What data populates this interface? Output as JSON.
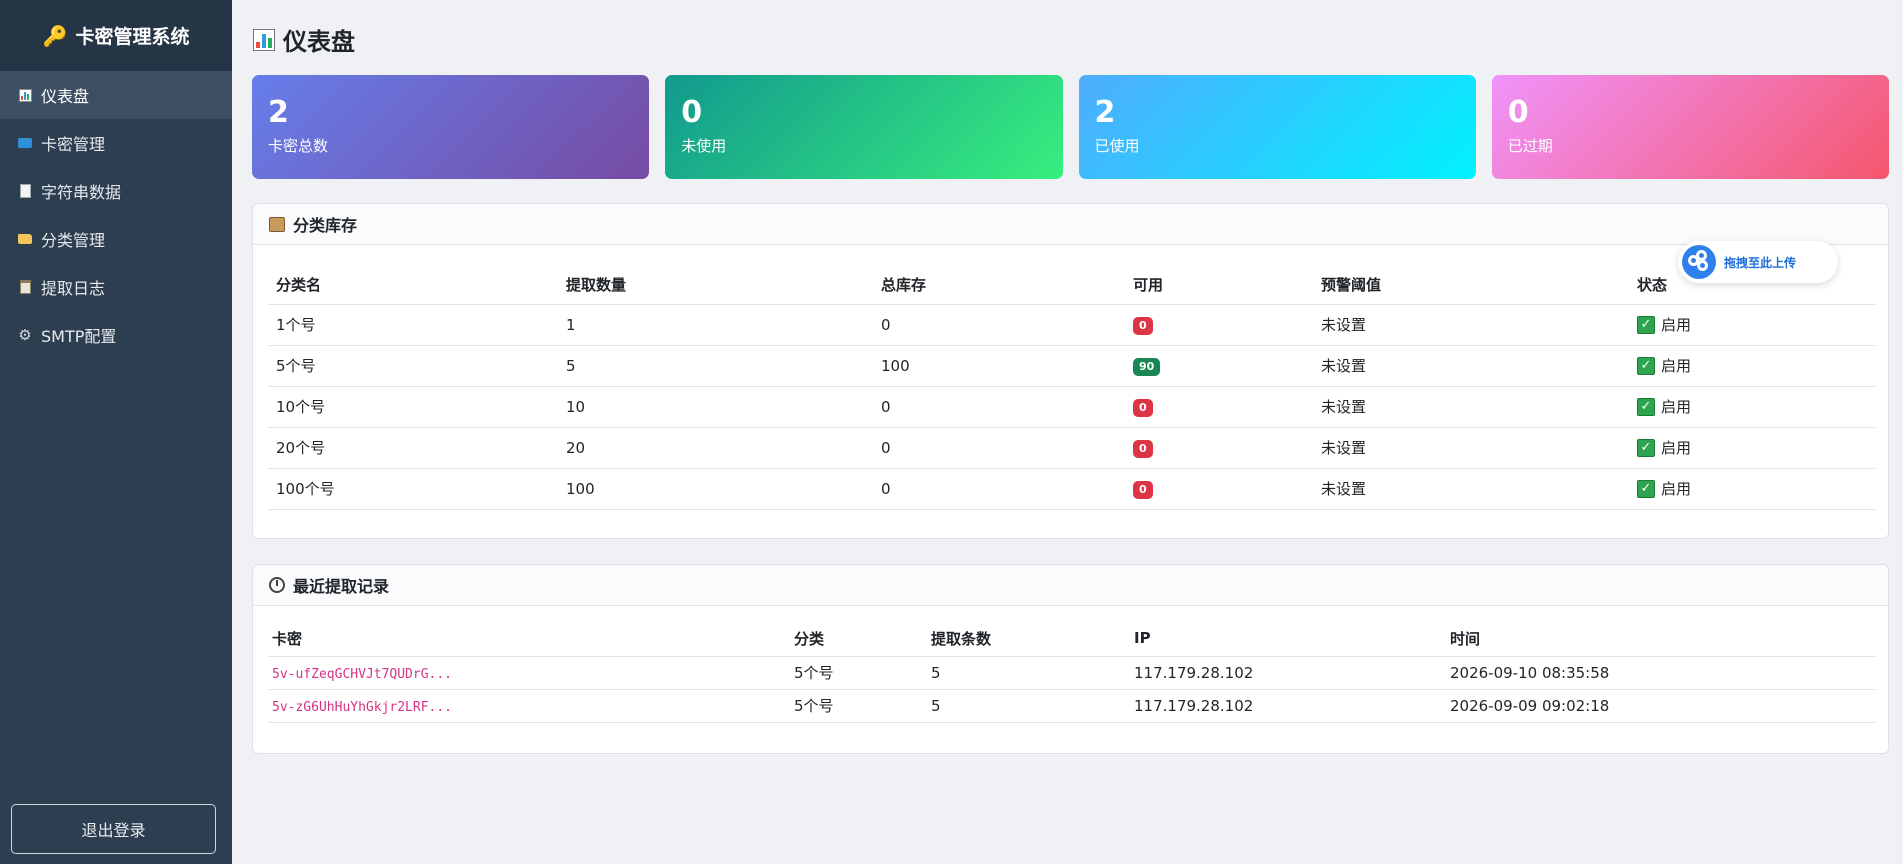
{
  "brand": {
    "title": "卡密管理系统"
  },
  "sidebar": {
    "items": [
      {
        "label": "仪表盘",
        "icon": "chart-icon",
        "active": true
      },
      {
        "label": "卡密管理",
        "icon": "card-icon"
      },
      {
        "label": "字符串数据",
        "icon": "document-icon"
      },
      {
        "label": "分类管理",
        "icon": "folder-icon"
      },
      {
        "label": "提取日志",
        "icon": "clipboard-icon"
      },
      {
        "label": "SMTP配置",
        "icon": "gear-icon"
      }
    ],
    "logout_label": "退出登录"
  },
  "page": {
    "title": "仪表盘"
  },
  "stats": [
    {
      "value": "2",
      "label": "卡密总数"
    },
    {
      "value": "0",
      "label": "未使用"
    },
    {
      "value": "2",
      "label": "已使用"
    },
    {
      "value": "0",
      "label": "已过期"
    }
  ],
  "inventory": {
    "title": "分类库存",
    "columns": [
      "分类名",
      "提取数量",
      "总库存",
      "可用",
      "预警阈值",
      "状态"
    ],
    "rows": [
      {
        "name": "1个号",
        "extract": "1",
        "total": "0",
        "available": "0",
        "threshold": "未设置",
        "status": "启用"
      },
      {
        "name": "5个号",
        "extract": "5",
        "total": "100",
        "available": "90",
        "threshold": "未设置",
        "status": "启用"
      },
      {
        "name": "10个号",
        "extract": "10",
        "total": "0",
        "available": "0",
        "threshold": "未设置",
        "status": "启用"
      },
      {
        "name": "20个号",
        "extract": "20",
        "total": "0",
        "available": "0",
        "threshold": "未设置",
        "status": "启用"
      },
      {
        "name": "100个号",
        "extract": "100",
        "total": "0",
        "available": "0",
        "threshold": "未设置",
        "status": "启用"
      }
    ]
  },
  "records": {
    "title": "最近提取记录",
    "columns": [
      "卡密",
      "分类",
      "提取条数",
      "IP",
      "时间"
    ],
    "rows": [
      {
        "card": "5v-ufZeqGCHVJt7QUDrG...",
        "category": "5个号",
        "count": "5",
        "ip": "117.179.28.102",
        "time": "2026-09-10 08:35:58"
      },
      {
        "card": "5v-zG6UhHuYhGkjr2LRF...",
        "category": "5个号",
        "count": "5",
        "ip": "117.179.28.102",
        "time": "2026-09-09 09:02:18"
      }
    ]
  },
  "floating": {
    "upload_label": "拖拽至此上传"
  },
  "colors": {
    "sidebar": "#2c3e50",
    "badge_red": "#dc3545",
    "badge_green": "#198754",
    "code_pink": "#d63384"
  }
}
